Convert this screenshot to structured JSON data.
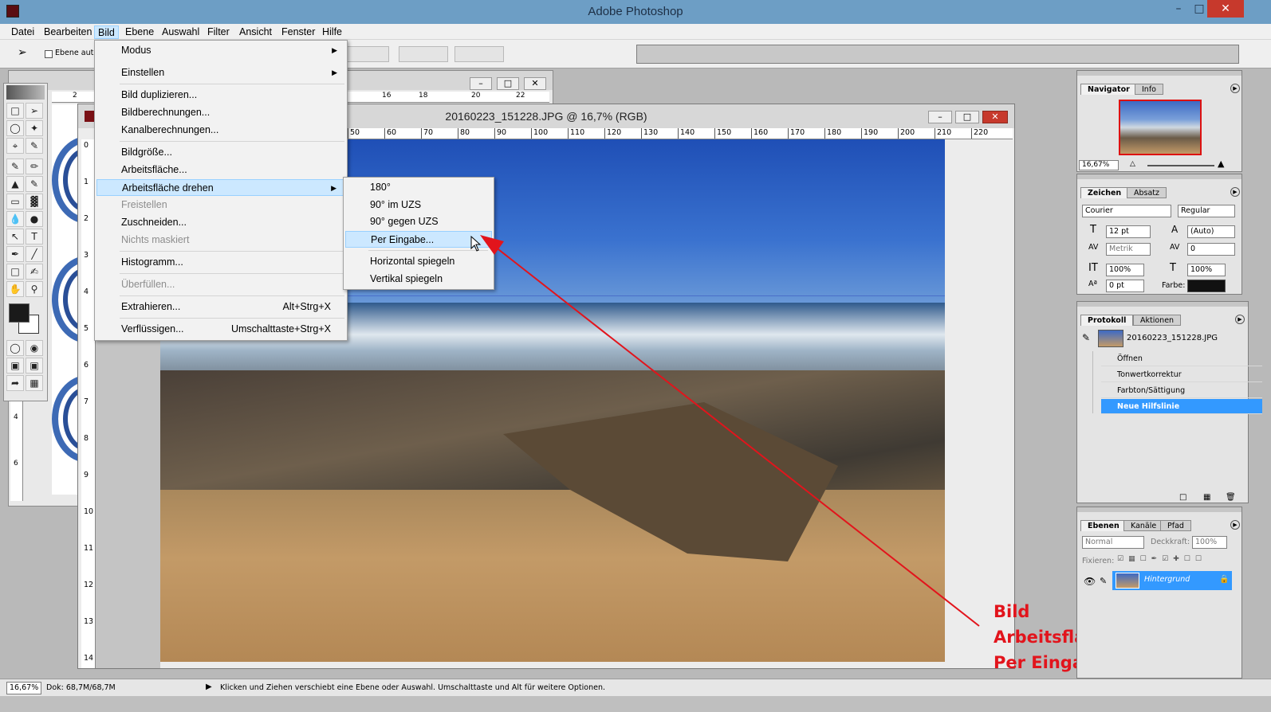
{
  "window": {
    "title": "Adobe Photoshop"
  },
  "menubar": [
    "Datei",
    "Bearbeiten",
    "Bild",
    "Ebene",
    "Auswahl",
    "Filter",
    "Ansicht",
    "Fenster",
    "Hilfe"
  ],
  "options": {
    "auto_select_label": "Ebene autom"
  },
  "document": {
    "title": "20160223_151228.JPG @ 16,7% (RGB)",
    "ruler_h": [
      "50",
      "60",
      "70",
      "80",
      "90",
      "100",
      "110",
      "120",
      "130",
      "140",
      "150",
      "160",
      "170",
      "180",
      "190",
      "200",
      "210",
      "220"
    ],
    "ruler_v": [
      "0",
      "1",
      "2",
      "3",
      "4",
      "5",
      "6",
      "7",
      "8",
      "9",
      "10",
      "11",
      "12",
      "13",
      "14"
    ]
  },
  "back_ruler": [
    "2",
    "16",
    "18",
    "20",
    "22"
  ],
  "back_ruler_v": [
    "4",
    "6"
  ],
  "bild_menu": {
    "items": [
      {
        "label": "Modus",
        "sub": true
      },
      {
        "label": "Einstellen",
        "sub": true
      },
      {
        "label": "Bild duplizieren..."
      },
      {
        "label": "Bildberechnungen..."
      },
      {
        "label": "Kanalberechnungen..."
      },
      {
        "label": "Bildgröße..."
      },
      {
        "label": "Arbeitsfläche..."
      },
      {
        "label": "Arbeitsfläche drehen",
        "sub": true
      },
      {
        "label": "Freistellen",
        "disabled": true
      },
      {
        "label": "Zuschneiden..."
      },
      {
        "label": "Nichts maskiert",
        "disabled": true
      },
      {
        "label": "Histogramm..."
      },
      {
        "label": "Überfüllen...",
        "disabled": true
      },
      {
        "label": "Extrahieren...",
        "shortcut": "Alt+Strg+X"
      },
      {
        "label": "Verflüssigen...",
        "shortcut": "Umschalttaste+Strg+X"
      }
    ]
  },
  "rotate_submenu": [
    "180°",
    "90° im UZS",
    "90° gegen UZS",
    "Per Eingabe...",
    "Horizontal spiegeln",
    "Vertikal spiegeln"
  ],
  "navigator": {
    "tabs": [
      "Navigator",
      "Info"
    ],
    "zoom": "16,67%"
  },
  "character": {
    "tabs": [
      "Zeichen",
      "Absatz"
    ],
    "font": "Courier",
    "style": "Regular",
    "size": "12 pt",
    "leading": "(Auto)",
    "kerning": "Metrik",
    "tracking": "0",
    "vscale": "100%",
    "hscale": "100%",
    "baseline": "0 pt",
    "color_label": "Farbe:"
  },
  "history": {
    "tabs": [
      "Protokoll",
      "Aktionen"
    ],
    "snapshot": "20160223_151228.JPG",
    "steps": [
      "Öffnen",
      "Tonwertkorrektur",
      "Farbton/Sättigung",
      "Neue Hilfslinie"
    ]
  },
  "layers": {
    "tabs": [
      "Ebenen",
      "Kanäle",
      "Pfad"
    ],
    "mode": "Normal",
    "opacity_label": "Deckkraft:",
    "opacity": "100%",
    "lock_label": "Fixieren:",
    "layer_name": "Hintergrund"
  },
  "status": {
    "zoom": "16,67%",
    "doc": "Dok: 68,7M/68,7M",
    "hint": "Klicken und Ziehen verschiebt eine Ebene oder Auswahl. Umschalttaste und Alt für weitere Optionen."
  },
  "annotation": {
    "line1": "Bild",
    "line2": "Arbeitsfläche",
    "line3": "Per Eingabe"
  },
  "colors": {
    "annotation": "#e2141c",
    "highlight": "#cce8ff",
    "history_selected": "#3399ff"
  }
}
